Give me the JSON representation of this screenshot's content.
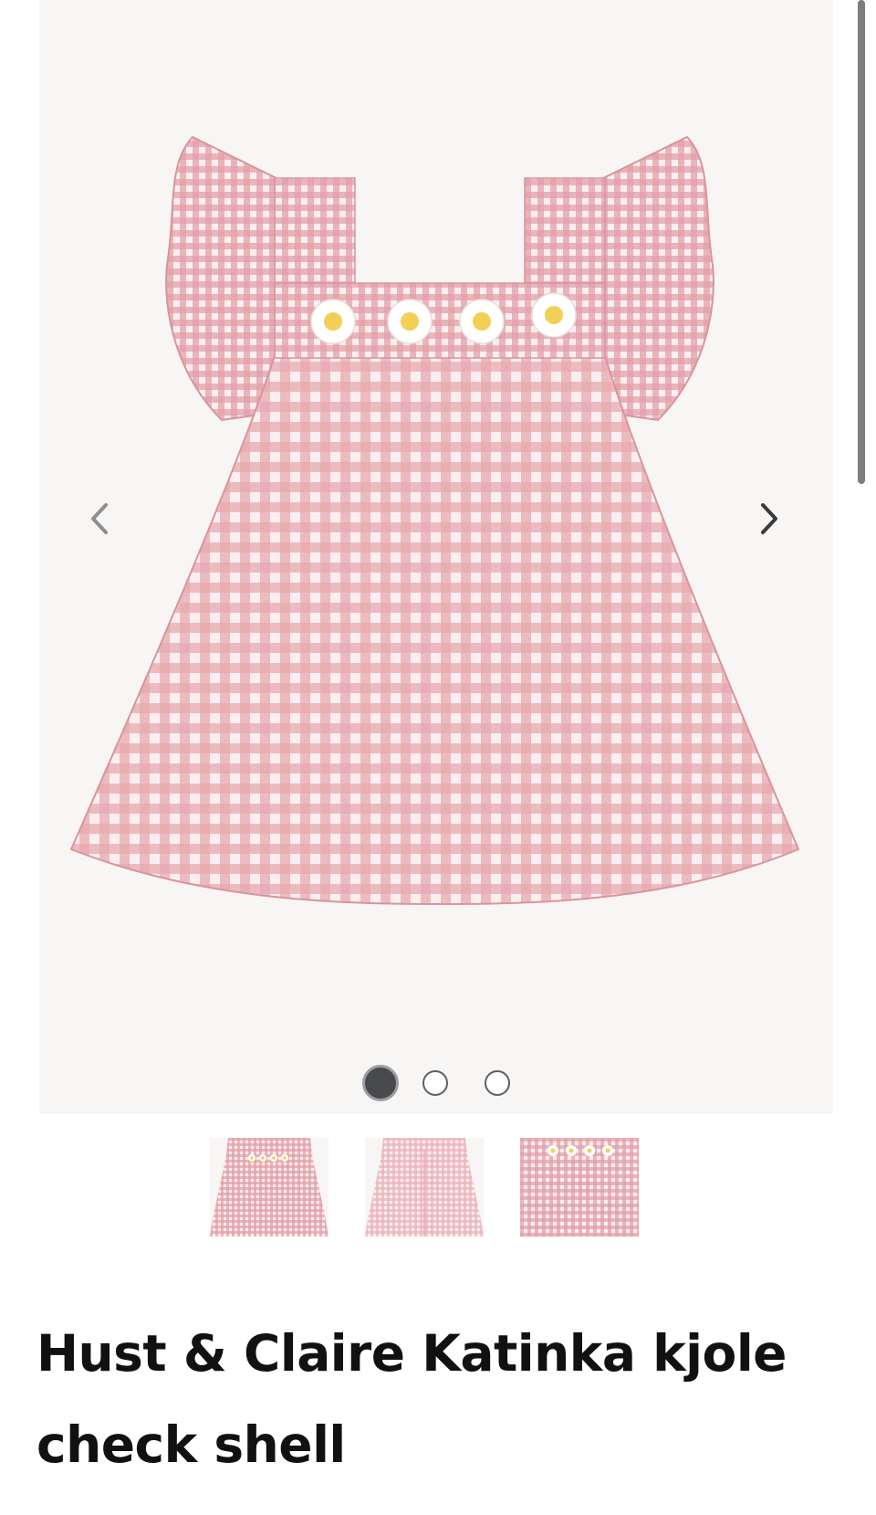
{
  "product": {
    "title": "Hust & Claire Katinka kjole check shell"
  },
  "gallery": {
    "image_count": 3,
    "active_index": 0,
    "prev_icon": "chevron-left-icon",
    "next_icon": "chevron-right-icon",
    "background_color": "#f8f6f4"
  },
  "thumbnails": [
    {
      "name": "thumbnail-front"
    },
    {
      "name": "thumbnail-back"
    },
    {
      "name": "thumbnail-detail"
    }
  ],
  "colors": {
    "gingham_pink": "#d98a92",
    "gingham_light": "#f6dfe1",
    "flower_center": "#f2cf56",
    "dot_active": "#484a4e",
    "title_text": "#111111"
  }
}
